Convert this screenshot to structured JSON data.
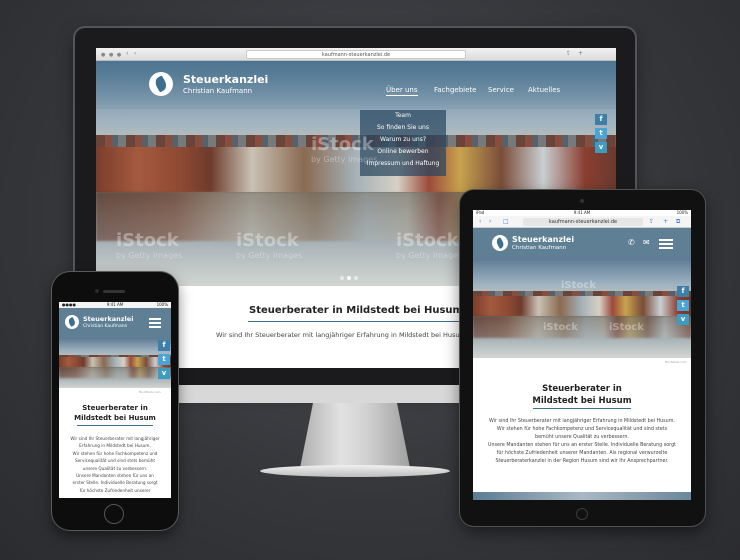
{
  "site": {
    "brand_title": "Steuerkanzlei",
    "brand_subtitle": "Christian Kaufmann",
    "url": "kaufmann-steuerkanzlei.de",
    "accent_color": "#3e6f8e"
  },
  "desktop": {
    "nav": [
      "Über uns",
      "Fachgebiete",
      "Service",
      "Aktuelles"
    ],
    "dropdown": [
      "Team",
      "So finden Sie uns",
      "Warum zu uns?",
      "Online bewerben",
      "Impressum und Haftung"
    ],
    "watermark_brand": "iStock",
    "watermark_sub": "by Getty Images",
    "heading": "Steuerberater in Mildstedt bei Husum",
    "intro": "Wir sind Ihr Steuerberater mit langjähriger Erfahrung in Mildstedt bei Husum."
  },
  "tablet": {
    "status_left": "iPad",
    "status_time": "9:41 AM",
    "status_battery": "100%",
    "photo_credit": "fbr-iStock.com",
    "heading_line1": "Steuerberater in",
    "heading_line2": "Mildstedt bei Husum",
    "body": [
      "Wir sind Ihr Steuerberater mit langjähriger Erfahrung in Mildstedt bei Husum.",
      "Wir stehen für hohe Fachkompetenz und Servicequalität und sind stets",
      "bemüht unsere Qualität zu verbessern.",
      "Unsere Mandanten stehen für uns an erster Stelle. Individuelle Beratung sorgt",
      "für höchste Zufriedenheit unserer Mandanten. Als regional verwurzelte",
      "Steuerberaterkanzlei in der Region Husum sind wir Ihr Ansprechpartner."
    ]
  },
  "phone": {
    "status_time": "9:41 AM",
    "status_battery": "100%",
    "photo_credit": "fbr-iStock.com",
    "heading_line1": "Steuerberater in",
    "heading_line2": "Mildstedt bei Husum",
    "body": [
      "Wir sind Ihr Steuerberater mit langjähriger",
      "Erfahrung in Mildstedt bei Husum.",
      "Wir stehen für hohe Fachkompetenz und",
      "Servicequalität und sind stets bemüht",
      "unsere Qualität zu verbessern.",
      "Unsere Mandanten stehen für uns an",
      "erster Stelle. Individuelle Beratung sorgt",
      "für höchste Zufriedenheit unserer"
    ]
  },
  "icons": {
    "facebook": "f",
    "twitter": "t",
    "vimeo": "v"
  }
}
